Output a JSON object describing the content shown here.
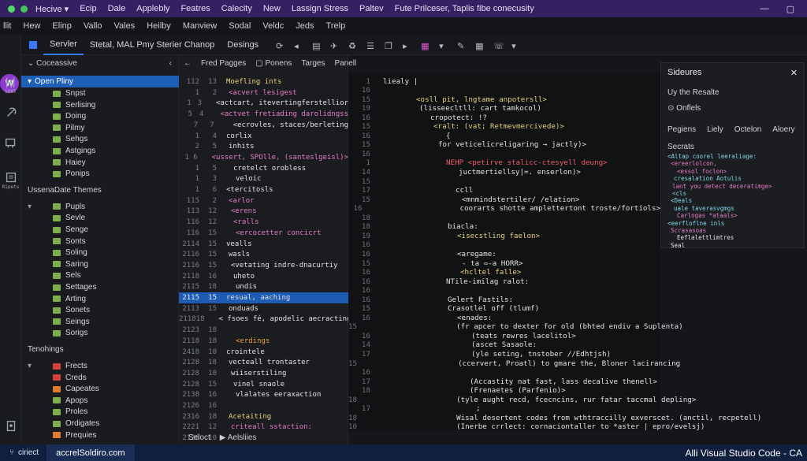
{
  "titlebar": {
    "menu": [
      "Hecive ▾",
      "Ecip",
      "Dale",
      "Applebly",
      "Featres",
      "Calecity",
      "New",
      "Lassign Stress",
      "Paltev",
      "Fute Prilceser, Taplis fibe conecusity"
    ],
    "controls": [
      "—",
      "▢"
    ]
  },
  "menubar": {
    "items": [
      "llit",
      "Hew",
      "Elinp",
      "Vallo",
      "Vales",
      "Heilby",
      "Manview",
      "Sodal",
      "Veldc",
      "Jeds",
      "Trelp"
    ]
  },
  "toolbar": {
    "tabs": [
      "Servler",
      "Stetal, MAL Pmy Sterier Chanop",
      "Desings"
    ]
  },
  "activity": {
    "avatar": "W",
    "labels": [
      "SONT",
      "Ripets"
    ]
  },
  "sidebar": {
    "header": "Coceassive",
    "sections": [
      {
        "title": "Open Pliny",
        "items": [
          {
            "label": "Snpst",
            "c": "g"
          },
          {
            "label": "Serlising",
            "c": "g"
          },
          {
            "label": "Doing",
            "c": "g"
          },
          {
            "label": "Pilmy",
            "c": "g"
          },
          {
            "label": "Sehgs",
            "c": "g"
          },
          {
            "label": "Astgings",
            "c": "g"
          },
          {
            "label": "Haiey",
            "c": "g"
          },
          {
            "label": "Ponips",
            "c": "g"
          }
        ]
      },
      {
        "title": "UssenaDate Themes",
        "items": [
          {
            "label": "Pupls",
            "c": "g"
          },
          {
            "label": "Sevle",
            "c": "g"
          },
          {
            "label": "Senge",
            "c": "g"
          },
          {
            "label": "Sonts",
            "c": "g"
          },
          {
            "label": "Soling",
            "c": "g"
          },
          {
            "label": "Saring",
            "c": "g"
          },
          {
            "label": "Sels",
            "c": "g"
          },
          {
            "label": "Settages",
            "c": "g"
          },
          {
            "label": "Arting",
            "c": "g"
          },
          {
            "label": "Sonets",
            "c": "g"
          },
          {
            "label": "Seings",
            "c": "g"
          },
          {
            "label": "Sorigs",
            "c": "g"
          }
        ]
      },
      {
        "title": "Tenohings",
        "items": [
          {
            "label": "Frects",
            "c": "r"
          },
          {
            "label": "Creds",
            "c": "r"
          },
          {
            "label": "Capeates",
            "c": "o"
          },
          {
            "label": "Apops",
            "c": "g"
          },
          {
            "label": "Proles",
            "c": "g"
          },
          {
            "label": "Ordigates",
            "c": "g"
          },
          {
            "label": "Prequies",
            "c": "o"
          }
        ]
      }
    ]
  },
  "tree": {
    "header": [
      "Fred Pagges",
      "Ponens",
      "Targes",
      "Panell"
    ],
    "lines": [
      [
        "112",
        "13",
        "Moefling ints",
        "y"
      ],
      [
        "1",
        "2",
        "<acvert lesigest",
        "p"
      ],
      [
        "1",
        "3",
        "<actcart, itevertingferstellior",
        "w"
      ],
      [
        "5",
        "4",
        "<actvet fretiading darolidngss",
        "p"
      ],
      [
        "7",
        "7",
        "<ecrovles, staces/berleting",
        "w"
      ],
      [
        "1",
        "4",
        "corlix",
        "w"
      ],
      [
        "2",
        "5",
        "inhits",
        "w"
      ],
      [
        "1",
        "6",
        "<ussert, SPOlle, (santeslgeisl)>",
        "p"
      ],
      [
        "1",
        "5",
        "cretelct orobless",
        "w"
      ],
      [
        "1",
        "3",
        "veloic",
        "w"
      ],
      [
        "1",
        "6",
        "<tercitosls",
        "w"
      ],
      [
        "115",
        "2",
        "<arlor",
        "p"
      ],
      [
        "113",
        "12",
        "<erens",
        "p"
      ],
      [
        "116",
        "12",
        "<ralls",
        "p"
      ],
      [
        "116",
        "15",
        "<ercocetter concicrt",
        "p"
      ],
      [
        "2114",
        "15",
        "vealls",
        "w"
      ],
      [
        "2116",
        "15",
        "wasls",
        "w"
      ],
      [
        "2116",
        "15",
        "<vetating indre-dnacurtiy",
        "w"
      ],
      [
        "2118",
        "16",
        "uheto",
        "w"
      ],
      [
        "2115",
        "18",
        "undis",
        "w"
      ],
      [
        "2115",
        "15",
        "resual, aaching",
        "w",
        "sel"
      ],
      [
        "2113",
        "15",
        "onduads",
        "w"
      ],
      [
        "2118",
        "18",
        "< fsoes fé, apodelic aecracting>",
        "w"
      ],
      [
        "2123",
        "18",
        "",
        "w"
      ],
      [
        "2118",
        "18",
        "<erdings",
        "o"
      ],
      [
        "2418",
        "10",
        "crointele",
        "w"
      ],
      [
        "2128",
        "18",
        "vecteall trontaster",
        "w"
      ],
      [
        "2128",
        "10",
        "wiiserstiling",
        "w"
      ],
      [
        "2128",
        "15",
        "vinel snaole",
        "w"
      ],
      [
        "2138",
        "16",
        "vlalates eeraxaction",
        "w"
      ],
      [
        "2126",
        "16",
        "",
        ""
      ],
      [
        "2316",
        "18",
        "Acetaiting",
        "y"
      ],
      [
        "2221",
        "12",
        "criteall sstaction:",
        "p"
      ],
      [
        "2126",
        "10",
        "",
        ""
      ]
    ]
  },
  "editor": {
    "lines": [
      [
        "1",
        "liealy |",
        "w"
      ],
      [
        "16",
        "",
        ""
      ],
      [
        "15",
        "<osll pit, lngtame anpotersll>",
        "y"
      ],
      [
        "19",
        "(lisseecltll: cart tamkocol)",
        "w"
      ],
      [
        "16",
        "cropotect: !?",
        "w"
      ],
      [
        "15",
        "<ralt: (vat; Retmevmercivede)>",
        "y"
      ],
      [
        "16",
        "{",
        "w"
      ],
      [
        "15",
        "for veticelicreligaring → jactly)>",
        "w"
      ],
      [
        "16",
        "",
        ""
      ],
      [
        "1",
        "NEHP <petirve stalicc-ctesyell deung>",
        "r"
      ],
      [
        "14",
        "juctmertiellsy|=. enserlon)>",
        "w"
      ],
      [
        "15",
        "",
        ""
      ],
      [
        "17",
        "ccll",
        "w"
      ],
      [
        "15",
        "<mnmindstertiler/ /elation>",
        "w"
      ],
      [
        "16",
        "coorarts shotte amplettertont troste/fortiols>",
        "w"
      ],
      [
        "18",
        "",
        ""
      ],
      [
        "18",
        "biacla:",
        "w"
      ],
      [
        "19",
        "<isecstling faelon>",
        "y"
      ],
      [
        "16",
        "",
        ""
      ],
      [
        "16",
        "<aregame:",
        "w"
      ],
      [
        "15",
        "- ta          ⇔-a HORR>",
        "w"
      ],
      [
        "16",
        "<hcltel falle>",
        "y"
      ],
      [
        "16",
        "NTile-imilag ralot:",
        "w"
      ],
      [
        "16",
        "",
        ""
      ],
      [
        "16",
        "Gelert Fastils:",
        "w"
      ],
      [
        "15",
        "Crasotlel off (tlumf)",
        "w"
      ],
      [
        "16",
        "<enades:",
        "w"
      ],
      [
        "15",
        "(fr apcer to dexter for old (bhted endiv a Suplenta)",
        "w"
      ],
      [
        "16",
        "(teats rewres lacelitol>",
        "w"
      ],
      [
        "14",
        "(ascet Sasaole:",
        "w"
      ],
      [
        "17",
        "(yle seting, tnstober //Edhtjsh)",
        "w"
      ],
      [
        "15",
        "(ccervert, Proatl) to gmare the, Bloner lacirancing",
        "w"
      ],
      [
        "16",
        "",
        ""
      ],
      [
        "17",
        "(Accastity nat fast, lass decalive thenell>",
        "w"
      ],
      [
        "18",
        "(Frenaetes (Parfenio)>",
        "w"
      ],
      [
        "18",
        "(tyle aught recd, fcecncins, rur fatar taccmal depling>",
        "w"
      ],
      [
        "17",
        ";",
        "w"
      ],
      [
        "18",
        "Wisal desertent codes from wthtraccilly exverscet. (anctil, recpetell)",
        "w"
      ],
      [
        "10",
        "(Inerbe crrlect: cornaciontaller to *aster | epro/evelsj)",
        "w"
      ]
    ]
  },
  "panel": {
    "title": "Sideures",
    "line1": "Uy the Resalte",
    "line2": "Onflels",
    "tabs": [
      "Pegiens",
      "Liely",
      "Octelon",
      "Aloery"
    ],
    "label": "Secrats",
    "code": [
      [
        "<Altap coorel leeraliage:",
        "c"
      ],
      [
        "<ereerlolcon,",
        "p"
      ],
      [
        "<essol foclon>",
        "p"
      ],
      [
        "cresalation Aotulis",
        "c"
      ],
      [
        "lant you detect deceratimge>",
        "p"
      ],
      [
        "<cls",
        "c"
      ],
      [
        "<Deals",
        "c"
      ],
      [
        "uale taverasvgmgs",
        "c"
      ],
      [
        "Carlogas *ataals>",
        "p"
      ],
      [
        "<eerfloflne inls",
        "c"
      ],
      [
        "Scrasasoas",
        "p"
      ],
      [
        "Eeflalettlimtres",
        "w"
      ],
      [
        "Seal",
        "w"
      ]
    ]
  },
  "bottom": {
    "tabs": [
      "Seloct",
      "Aelsliies"
    ]
  },
  "status": {
    "left": "ciriect",
    "mid": "accrelSoldiro.com",
    "right": "Alli Visual Studio Code - CA"
  }
}
